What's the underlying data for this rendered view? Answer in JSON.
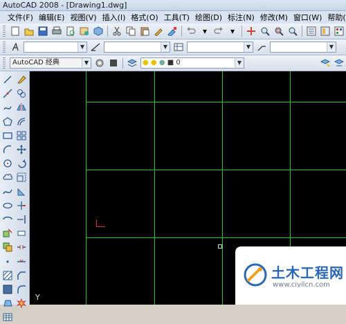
{
  "window": {
    "title": "AutoCAD 2008 - [Drawing1.dwg]"
  },
  "menu": {
    "items": [
      {
        "label": "文件(F)"
      },
      {
        "label": "编辑(E)"
      },
      {
        "label": "视图(V)"
      },
      {
        "label": "插入(I)"
      },
      {
        "label": "格式(O)"
      },
      {
        "label": "工具(T)"
      },
      {
        "label": "绘图(D)"
      },
      {
        "label": "标注(N)"
      },
      {
        "label": "修改(M)"
      },
      {
        "label": "窗口(W)"
      },
      {
        "label": "帮助(H)"
      }
    ]
  },
  "toolbar3": {
    "workspace": "AutoCAD 经典",
    "layer_value": "0"
  },
  "canvas": {
    "background": "#000000",
    "grid_color": "#2bc42b",
    "ucs_y_label": "Y"
  },
  "watermark": {
    "title": "土木工程网",
    "url": "www.civilcn.com"
  }
}
